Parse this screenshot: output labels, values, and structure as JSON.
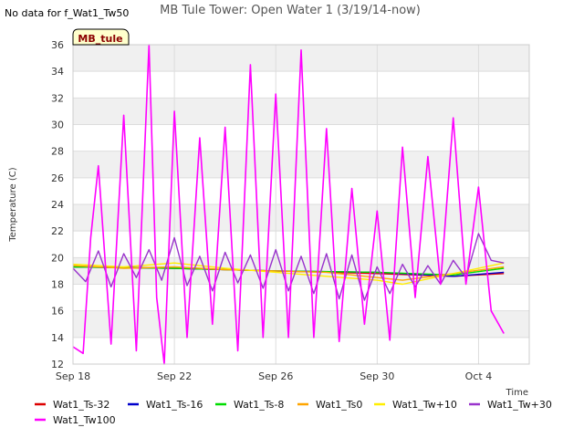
{
  "colors": {
    "Wat1_Ts-32": "#dd0000",
    "Wat1_Ts-16": "#0000cc",
    "Wat1_Ts-8": "#00dd00",
    "Wat1_Ts0": "#ffa500",
    "Wat1_Tw+10": "#ffee00",
    "Wat1_Tw+30": "#9933cc",
    "Wat1_Tw100": "#ff00ff",
    "band": "#f0f0f0",
    "badge_fill": "#ffffcc"
  },
  "header": {
    "no_data_note": "No data for f_Wat1_Tw50",
    "badge": "MB_tule"
  },
  "chart_data": {
    "type": "line",
    "title": "MB Tule Tower: Open Water 1 (3/19/14-now)",
    "xlabel": "Time",
    "ylabel": "Temperature (C)",
    "ylim": [
      12,
      36
    ],
    "yticks": [
      12,
      14,
      16,
      18,
      20,
      22,
      24,
      26,
      28,
      30,
      32,
      34,
      36
    ],
    "xlim": [
      "2014-09-18",
      "2014-10-06"
    ],
    "xticks": [
      {
        "date": "2014-09-18",
        "label": "Sep 18"
      },
      {
        "date": "2014-09-22",
        "label": "Sep 22"
      },
      {
        "date": "2014-09-26",
        "label": "Sep 26"
      },
      {
        "date": "2014-09-30",
        "label": "Sep 30"
      },
      {
        "date": "2014-10-04",
        "label": "Oct 4"
      }
    ],
    "grid": true,
    "legend_position": "bottom",
    "series": [
      {
        "name": "Wat1_Ts-32",
        "x": [
          "2014-09-18",
          "2014-09-22",
          "2014-09-26",
          "2014-09-30",
          "2014-10-03",
          "2014-10-05"
        ],
        "y": [
          19.3,
          19.2,
          19.0,
          18.8,
          18.6,
          18.8
        ]
      },
      {
        "name": "Wat1_Ts-16",
        "x": [
          "2014-09-18",
          "2014-09-22",
          "2014-09-26",
          "2014-09-30",
          "2014-10-03",
          "2014-10-05"
        ],
        "y": [
          19.3,
          19.2,
          19.0,
          18.9,
          18.6,
          18.9
        ]
      },
      {
        "name": "Wat1_Ts-8",
        "x": [
          "2014-09-18",
          "2014-09-22",
          "2014-09-26",
          "2014-09-30",
          "2014-10-03",
          "2014-10-05"
        ],
        "y": [
          19.3,
          19.2,
          19.0,
          18.9,
          18.7,
          19.2
        ]
      },
      {
        "name": "Wat1_Ts0",
        "x": [
          "2014-09-18",
          "2014-09-20",
          "2014-09-22",
          "2014-09-24",
          "2014-09-26",
          "2014-09-28",
          "2014-09-30",
          "2014-10-01",
          "2014-10-03",
          "2014-10-05"
        ],
        "y": [
          19.4,
          19.2,
          19.3,
          19.1,
          19.0,
          18.9,
          18.5,
          18.3,
          18.8,
          19.3
        ]
      },
      {
        "name": "Wat1_Tw+10",
        "x": [
          "2014-09-18",
          "2014-09-20",
          "2014-09-22",
          "2014-09-24",
          "2014-09-26",
          "2014-09-28",
          "2014-09-30",
          "2014-10-01",
          "2014-10-03",
          "2014-10-05"
        ],
        "y": [
          19.5,
          19.3,
          19.6,
          19.2,
          18.9,
          18.6,
          18.3,
          18.0,
          18.8,
          19.6
        ]
      },
      {
        "name": "Wat1_Tw+30",
        "x": [
          "2014-09-18",
          "2014-09-18.5",
          "2014-09-19",
          "2014-09-19.5",
          "2014-09-20",
          "2014-09-20.5",
          "2014-09-21",
          "2014-09-21.5",
          "2014-09-22",
          "2014-09-22.5",
          "2014-09-23",
          "2014-09-23.5",
          "2014-09-24",
          "2014-09-24.5",
          "2014-09-25",
          "2014-09-25.5",
          "2014-09-26",
          "2014-09-26.5",
          "2014-09-27",
          "2014-09-27.5",
          "2014-09-28",
          "2014-09-28.5",
          "2014-09-29",
          "2014-09-29.5",
          "2014-09-30",
          "2014-09-30.5",
          "2014-10-01",
          "2014-10-01.5",
          "2014-10-02",
          "2014-10-02.5",
          "2014-10-03",
          "2014-10-03.5",
          "2014-10-04",
          "2014-10-04.5",
          "2014-10-05"
        ],
        "y": [
          19.2,
          18.2,
          20.5,
          17.8,
          20.3,
          18.5,
          20.6,
          18.3,
          21.5,
          17.9,
          20.1,
          17.5,
          20.4,
          18.1,
          20.2,
          17.7,
          20.6,
          17.5,
          20.1,
          17.3,
          20.3,
          16.9,
          20.2,
          16.8,
          19.3,
          17.3,
          19.5,
          17.8,
          19.4,
          18.0,
          19.8,
          18.5,
          21.8,
          19.8,
          19.6
        ]
      },
      {
        "name": "Wat1_Tw100",
        "x": [
          "2014-09-18",
          "2014-09-18.4",
          "2014-09-18.7",
          "2014-09-19",
          "2014-09-19.5",
          "2014-09-20",
          "2014-09-20.5",
          "2014-09-21",
          "2014-09-21.3",
          "2014-09-21.6",
          "2014-09-22",
          "2014-09-22.5",
          "2014-09-23",
          "2014-09-23.5",
          "2014-09-24",
          "2014-09-24.5",
          "2014-09-25",
          "2014-09-25.5",
          "2014-09-26",
          "2014-09-26.5",
          "2014-09-27",
          "2014-09-27.5",
          "2014-09-28",
          "2014-09-28.5",
          "2014-09-29",
          "2014-09-29.5",
          "2014-09-30",
          "2014-09-30.5",
          "2014-10-01",
          "2014-10-01.5",
          "2014-10-02",
          "2014-10-02.5",
          "2014-10-03",
          "2014-10-03.5",
          "2014-10-04",
          "2014-10-04.5",
          "2014-10-05"
        ],
        "y": [
          13.3,
          12.8,
          21.5,
          26.9,
          13.5,
          30.7,
          13.0,
          36.0,
          17.0,
          12.0,
          31.0,
          14.0,
          29.0,
          15.0,
          29.8,
          13.0,
          34.5,
          14.0,
          32.3,
          14.0,
          35.6,
          14.0,
          29.7,
          13.7,
          25.2,
          15.0,
          23.5,
          13.8,
          28.3,
          17.0,
          27.6,
          18.0,
          30.5,
          18.0,
          25.3,
          16.0,
          14.3
        ]
      }
    ]
  }
}
